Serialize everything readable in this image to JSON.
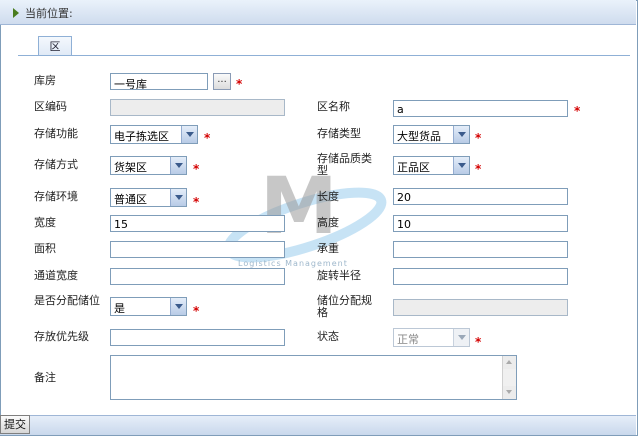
{
  "breadcrumb": {
    "label": "当前位置:"
  },
  "tab": {
    "label": "区"
  },
  "fields": {
    "warehouse": {
      "label": "库房",
      "value": "一号库",
      "browse": "..."
    },
    "zone_code": {
      "label": "区编码",
      "value": ""
    },
    "zone_name": {
      "label": "区名称",
      "value": "a"
    },
    "storage_function": {
      "label": "存储功能",
      "value": "电子拣选区"
    },
    "storage_type": {
      "label": "存储类型",
      "value": "大型货品"
    },
    "storage_method": {
      "label": "存储方式",
      "value": "货架区"
    },
    "quality_type": {
      "label": "存储品质类型",
      "value": "正品区"
    },
    "environment": {
      "label": "存储环境",
      "value": "普通区"
    },
    "length": {
      "label": "长度",
      "value": "20"
    },
    "width": {
      "label": "宽度",
      "value": "15"
    },
    "height": {
      "label": "高度",
      "value": "10"
    },
    "area": {
      "label": "面积",
      "value": ""
    },
    "load": {
      "label": "承重",
      "value": ""
    },
    "aisle_width": {
      "label": "通道宽度",
      "value": ""
    },
    "turn_radius": {
      "label": "旋转半径",
      "value": ""
    },
    "allocate_storage": {
      "label": "是否分配储位",
      "value": "是"
    },
    "allocation_rule": {
      "label": "储位分配规格",
      "value": ""
    },
    "priority": {
      "label": "存放优先级",
      "value": ""
    },
    "status": {
      "label": "状态",
      "value": "正常"
    },
    "remark": {
      "label": "备注",
      "value": ""
    }
  },
  "required_mark": "*",
  "actions": {
    "submit": "提交"
  },
  "watermark": {
    "text": "Logistics Management",
    "letter": "M"
  },
  "colors": {
    "required": "#d40000",
    "accent": "#8fb0d6",
    "watermark": "#4aa3df"
  }
}
